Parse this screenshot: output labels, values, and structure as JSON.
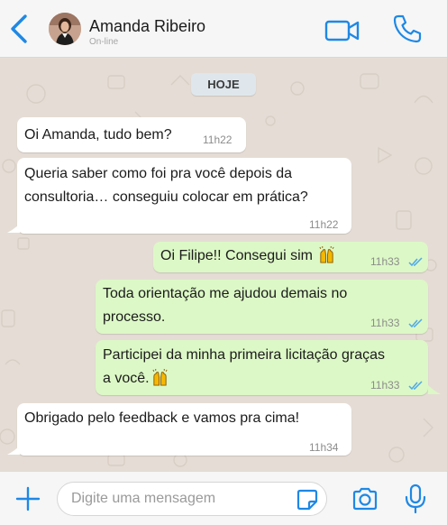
{
  "header": {
    "contact_name": "Amanda Ribeiro",
    "status": "On-line",
    "icons": [
      "back-chevron-icon",
      "video-camera-icon",
      "phone-icon"
    ]
  },
  "chat": {
    "date_label": "HOJE",
    "messages": [
      {
        "direction": "incoming",
        "lines": [
          "Oi Amanda, tudo bem?"
        ],
        "time": "11h22"
      },
      {
        "direction": "incoming",
        "lines": [
          "Queria saber como foi pra você depois da",
          "consultoria… conseguiu colocar em prática?"
        ],
        "time": "11h22"
      },
      {
        "direction": "outgoing",
        "lines": [
          "Oi Filipe!! Consegui sim"
        ],
        "emoji": "raised-hands-emoji",
        "time": "11h33",
        "status": "read"
      },
      {
        "direction": "outgoing",
        "lines": [
          "Toda orientação me ajudou demais no",
          "processo."
        ],
        "time": "11h33",
        "status": "read"
      },
      {
        "direction": "outgoing",
        "lines": [
          "Participei da minha primeira licitação graças",
          "a você."
        ],
        "emoji": "raised-hands-emoji",
        "time": "11h33",
        "status": "read"
      },
      {
        "direction": "incoming",
        "lines": [
          "Obrigado pelo feedback e vamos pra cima!"
        ],
        "time": "11h34"
      }
    ]
  },
  "composer": {
    "placeholder": "Digite uma mensagem",
    "value": "",
    "icons": [
      "plus-icon",
      "sticker-icon",
      "camera-icon",
      "microphone-icon"
    ]
  },
  "colors": {
    "accent": "#1e88e5",
    "incoming_bubble": "#ffffff",
    "outgoing_bubble": "#dcf8c6",
    "chat_background": "#e5ddd5",
    "read_ticks": "#4fa9e6"
  }
}
